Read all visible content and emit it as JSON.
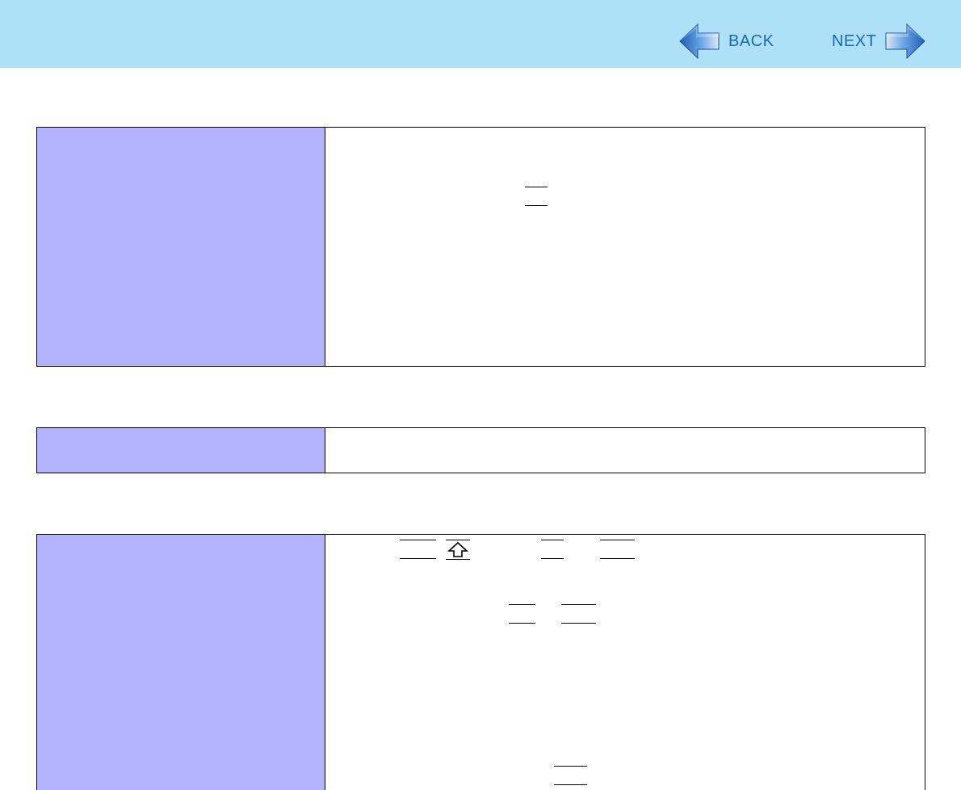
{
  "navigation": {
    "back_label": "BACK",
    "next_label": "NEXT"
  },
  "colors": {
    "header_background": "#aee1f8",
    "label_cell_background": "#b3b3ff",
    "nav_text": "#1a66b8",
    "arrow_blue": "#2a6fc0"
  },
  "icons": {
    "back": "back-arrow-icon",
    "next": "next-arrow-icon",
    "shift": "shift-key-icon"
  }
}
